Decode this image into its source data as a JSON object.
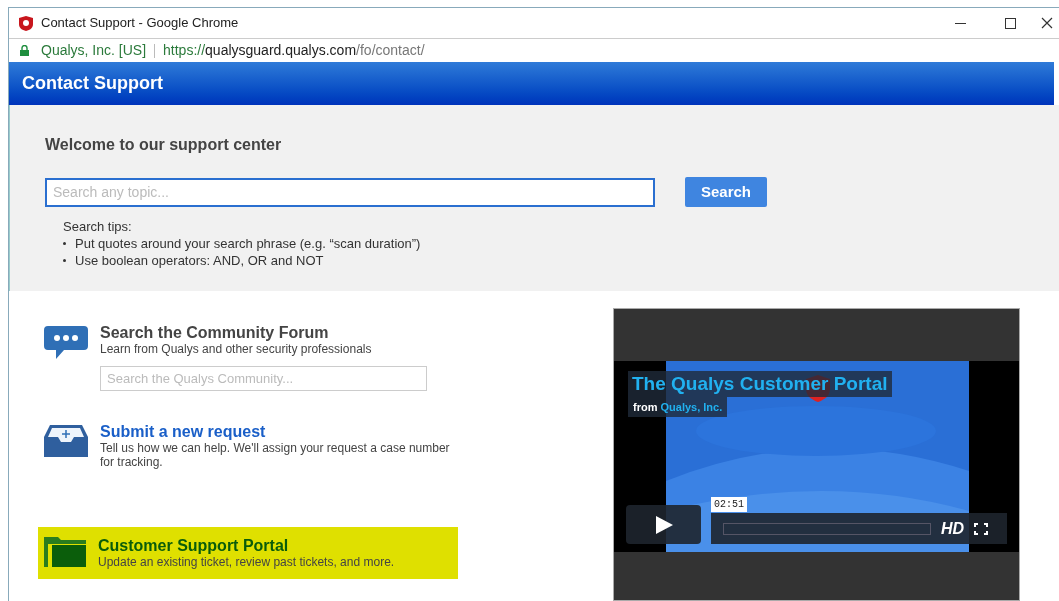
{
  "window": {
    "title": "Contact Support - Google Chrome"
  },
  "address_bar": {
    "site_identity": "Qualys, Inc. [US]",
    "url_scheme": "https://",
    "url_host": "qualysguard.qualys.com",
    "url_path": "/fo/contact/"
  },
  "header": {
    "title": "Contact Support"
  },
  "search": {
    "heading": "Welcome to our support center",
    "placeholder": "Search any topic...",
    "button": "Search",
    "tips_title": "Search tips:",
    "tips": [
      "Put quotes around your search phrase (e.g. “scan duration”)",
      "Use boolean operators: AND, OR and NOT"
    ]
  },
  "options": [
    {
      "kind": "forum",
      "title": "Search the Community Forum",
      "description": "Learn from Qualys and other security professionals",
      "placeholder": "Search the Qualys Community...",
      "highlighted": false
    },
    {
      "kind": "request",
      "title": "Submit a new request",
      "description": "Tell us how we can help. We'll assign your request a case number for tracking.",
      "highlighted": false
    },
    {
      "kind": "portal",
      "title": "Customer Support Portal",
      "description": "Update an existing ticket, review past tickets, and more.",
      "highlighted": true
    }
  ],
  "video": {
    "title": "The Qualys Customer Portal",
    "byline_prefix": "from",
    "byline_author": "Qualys, Inc.",
    "time": "02:51",
    "quality": "HD"
  }
}
